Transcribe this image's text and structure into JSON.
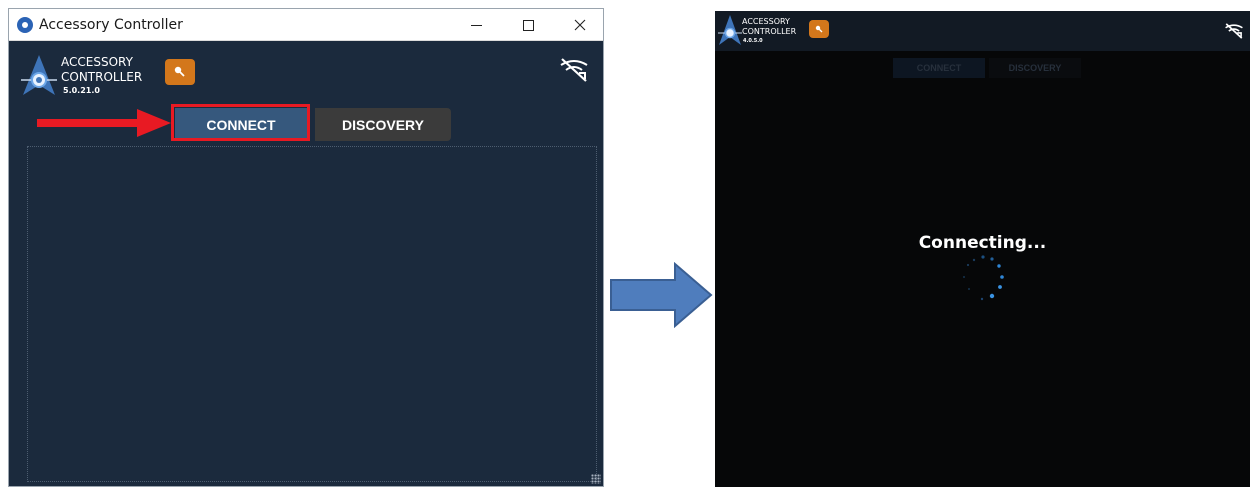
{
  "left_window": {
    "title": "Accessory Controller",
    "logo": {
      "line1": "ACCESSORY",
      "line2": "CONTROLLER",
      "version": "5.0.21.0"
    },
    "tabs": {
      "connect": "CONNECT",
      "discovery": "DISCOVERY"
    },
    "highlighted_tab": "connect"
  },
  "right_window": {
    "logo": {
      "line1": "ACCESSORY",
      "line2": "CONTROLLER",
      "version": "4.0.5.0"
    },
    "tabs": {
      "connect": "CONNECT",
      "discovery": "DISCOVERY"
    },
    "status": "Connecting..."
  },
  "icons": {
    "app": "app-icon",
    "key": "key-icon",
    "wifi_off": "wifi-off-icon",
    "minimize": "minimize-icon",
    "maximize": "maximize-icon",
    "close": "close-icon",
    "spinner": "loading-spinner-icon"
  },
  "colors": {
    "app_background": "#1b2a3d",
    "connect_tab": "#36587d",
    "discovery_tab": "#3b3b3b",
    "key_button": "#d3771b",
    "annotation_red": "#e81a23",
    "transition_arrow": "#4f7dbd",
    "loading_background": "#060708",
    "spinner_blue": "#2f86d6"
  }
}
